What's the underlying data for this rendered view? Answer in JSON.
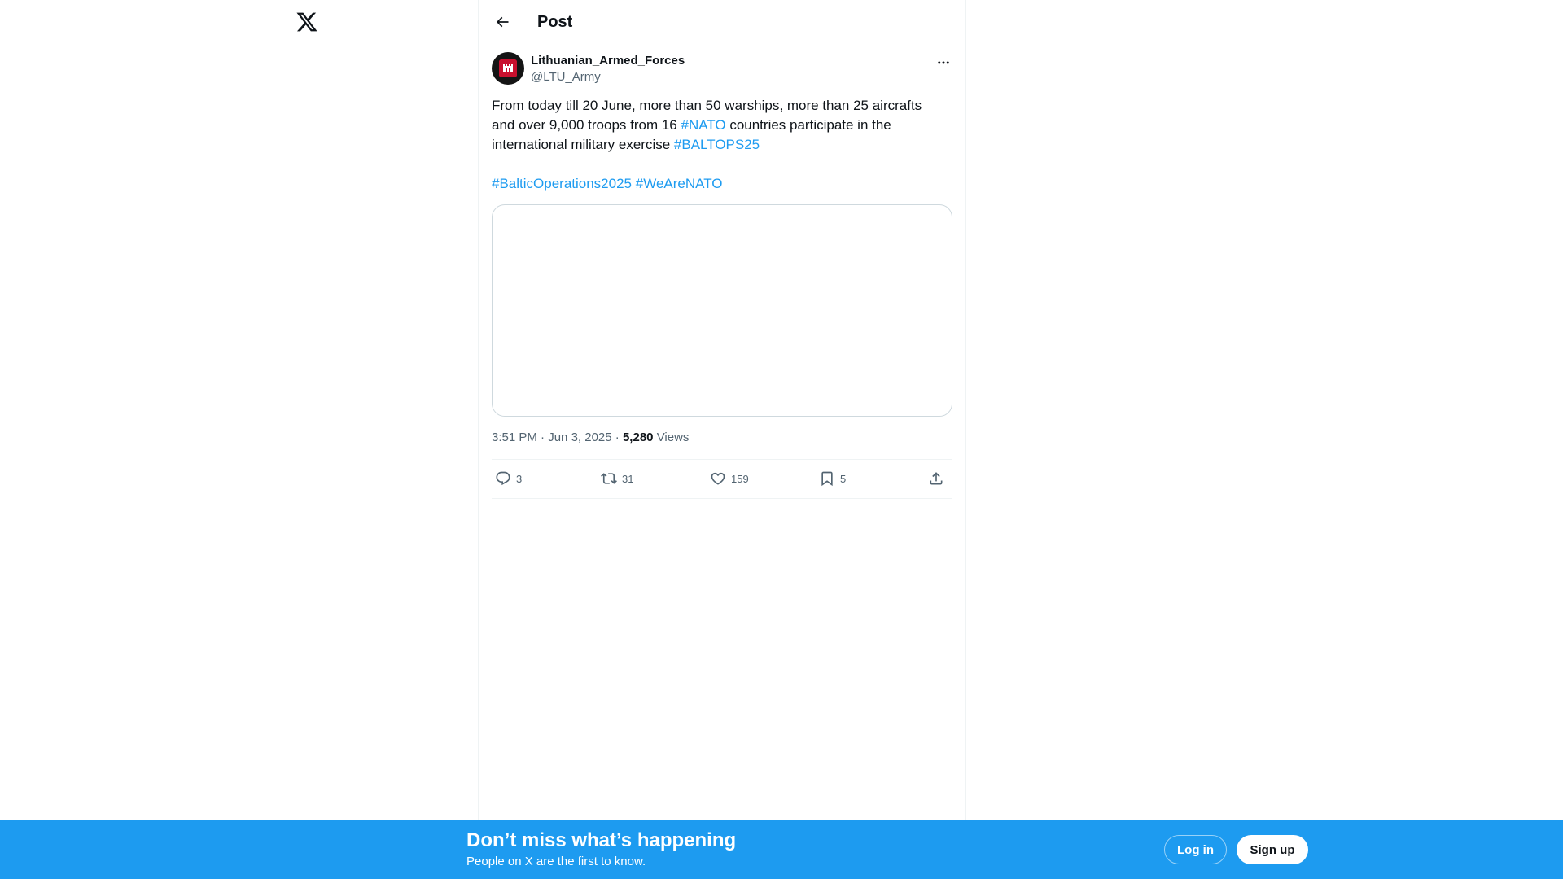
{
  "icons": {
    "logo": "x-logo-icon",
    "back": "arrow-left-icon",
    "more": "more-horizontal-icon",
    "reply": "reply-icon",
    "repost": "repost-icon",
    "like": "heart-icon",
    "bookmark": "bookmark-icon",
    "share": "share-icon"
  },
  "colors": {
    "accent": "#1d9bf0",
    "text": "#0f1419",
    "secondary_text": "#536471",
    "border": "#eff3f4"
  },
  "header": {
    "title": "Post"
  },
  "post": {
    "author": {
      "display_name": "Lithuanian_Armed_Forces",
      "handle": "@LTU_Army"
    },
    "text": {
      "line1": "From today till 20 June, more than 50 warships, more than 25 aircrafts",
      "line2_before": "and over 9,000 troops from 16 ",
      "line2_link": "#NATO",
      "line2_after": " countries participate in the",
      "line3_before": "international military exercise ",
      "line3_link": "#BALTOPS25",
      "hashtag1": "#BalticOperations2025",
      "hashtag2": "#WeAreNATO"
    },
    "time": "3:51 PM",
    "date": "Jun 3, 2025",
    "views_count": "5,280",
    "views_label": "Views",
    "stats": {
      "replies": "3",
      "reposts": "31",
      "likes": "159",
      "bookmarks": "5"
    }
  },
  "banner": {
    "title": "Don’t miss what’s happening",
    "subtitle": "People on X are the first to know.",
    "login_label": "Log in",
    "signup_label": "Sign up"
  }
}
